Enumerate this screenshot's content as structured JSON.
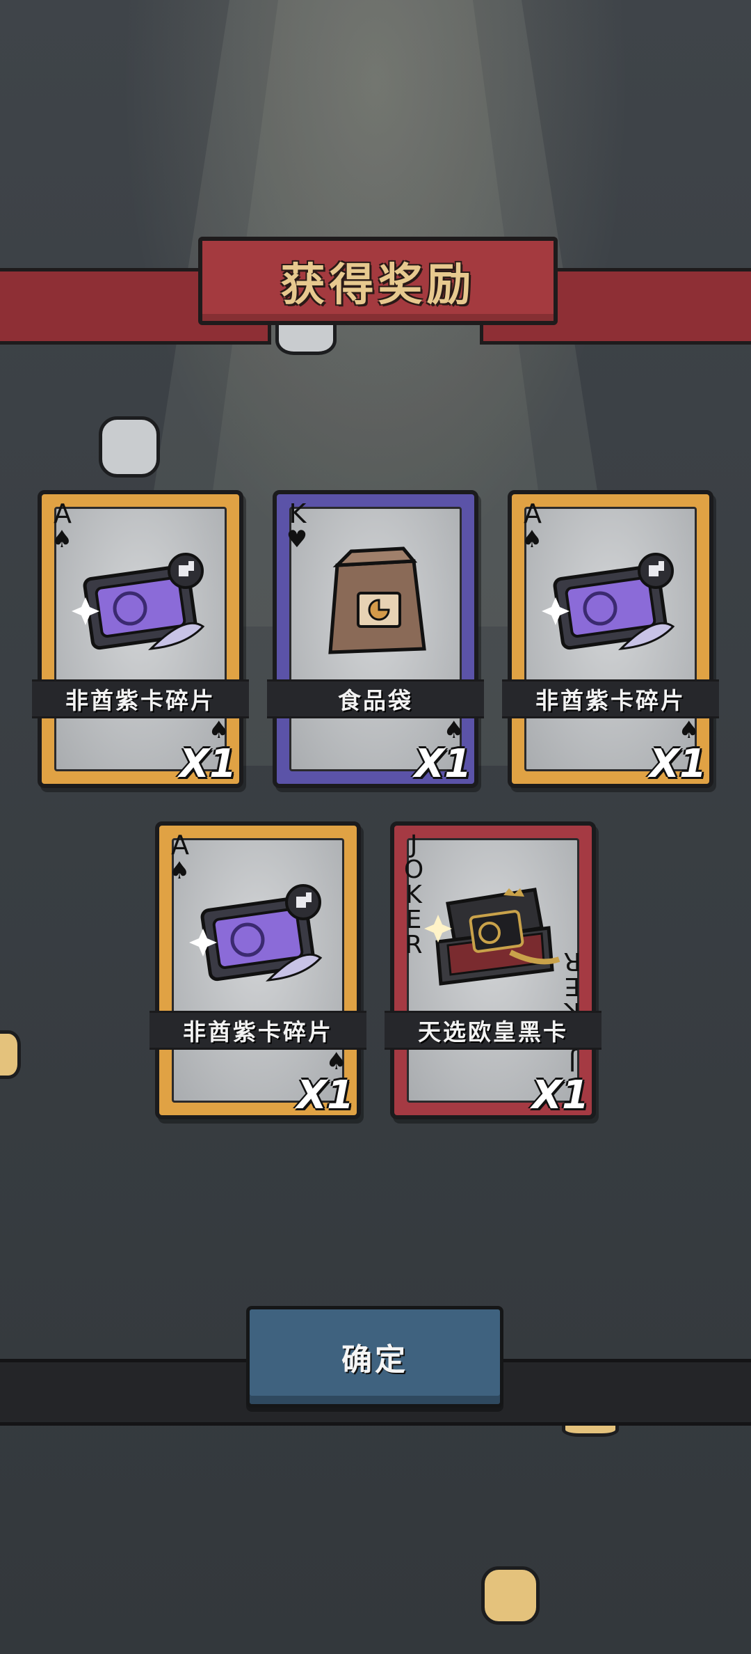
{
  "header": {
    "title": "获得奖励"
  },
  "rewards": [
    {
      "rank": "A",
      "suit_icon": "spade-icon",
      "name": "非酋紫卡碎片",
      "quantity": "X1",
      "frame_color": "#e0a244",
      "art_icon": "purple-card-fragment-icon"
    },
    {
      "rank": "K",
      "suit_icon": "heart-icon",
      "name": "食品袋",
      "quantity": "X1",
      "frame_color": "#5b53a8",
      "art_icon": "food-bag-icon"
    },
    {
      "rank": "A",
      "suit_icon": "spade-icon",
      "name": "非酋紫卡碎片",
      "quantity": "X1",
      "frame_color": "#e0a244",
      "art_icon": "purple-card-fragment-icon"
    },
    {
      "rank": "A",
      "suit_icon": "spade-icon",
      "name": "非酋紫卡碎片",
      "quantity": "X1",
      "frame_color": "#e0a244",
      "art_icon": "purple-card-fragment-icon"
    },
    {
      "rank": "JOKER",
      "suit_icon": "",
      "name": "天选欧皇黑卡",
      "quantity": "X1",
      "frame_color": "#a53a43",
      "art_icon": "black-card-box-icon"
    }
  ],
  "confirm": {
    "label": "确定"
  },
  "colors": {
    "banner": "#a43a3f",
    "button": "#3f627f",
    "background": "#3a3f44"
  }
}
